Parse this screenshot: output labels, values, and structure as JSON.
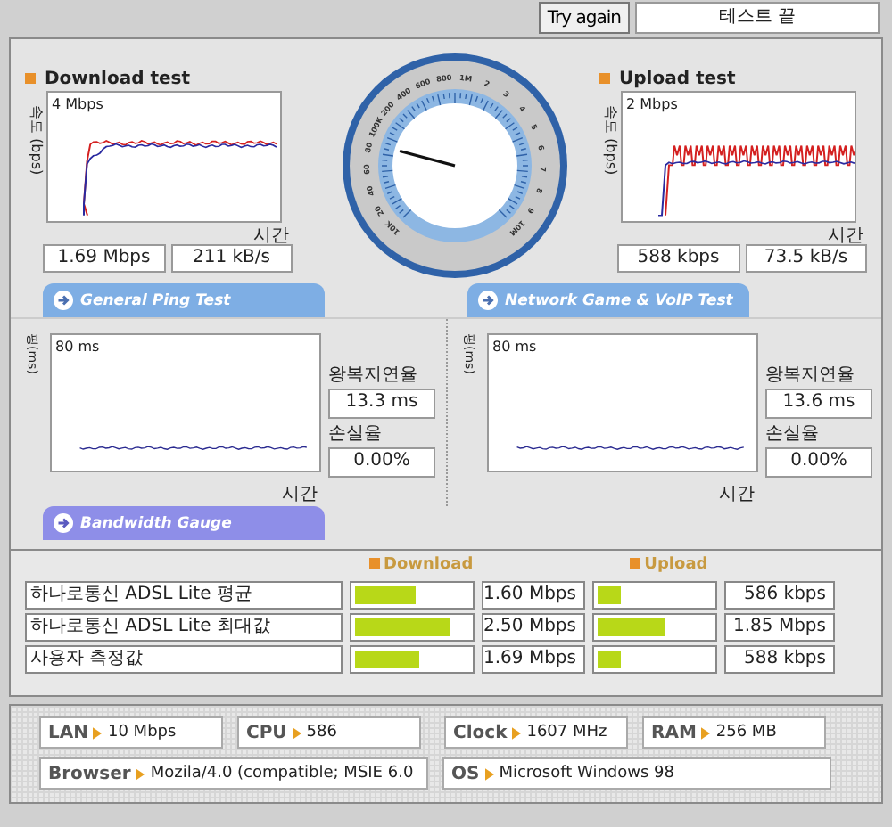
{
  "top_bar": {
    "button": "Try again",
    "status": "테스트 끝"
  },
  "speed_tests": [
    {
      "kind": "smooth",
      "title": "Download test",
      "y_axis": "속도 (bps)",
      "max_label": "4 Mbps",
      "x_axis": "시간",
      "readings": [
        "1.69 Mbps",
        "211 kB/s"
      ]
    },
    {
      "kind": "spiky",
      "title": "Upload test",
      "y_axis": "속도 (bps)",
      "max_label": "2 Mbps",
      "x_axis": "시간",
      "readings": [
        "588 kbps",
        "73.5 kB/s"
      ]
    }
  ],
  "gauge": {
    "labels": [
      "10K",
      "20",
      "40",
      "60",
      "80",
      "100K",
      "200",
      "400",
      "600",
      "800",
      "1M",
      "2",
      "3",
      "4",
      "5",
      "6",
      "7",
      "8",
      "9",
      "10M"
    ]
  },
  "section_tabs": [
    "General Ping Test",
    "Network Game & VoIP Test"
  ],
  "ping_tests": [
    {
      "y_axis": "핑(ms)",
      "max_label": "80 ms",
      "x_axis": "시간",
      "latency_label": "왕복지연율",
      "latency": "13.3 ms",
      "loss_label": "손실율",
      "loss": "0.00%"
    },
    {
      "y_axis": "핑(ms)",
      "max_label": "80 ms",
      "x_axis": "시간",
      "latency_label": "왕복지연율",
      "latency": "13.6 ms",
      "loss_label": "손실율",
      "loss": "0.00%"
    }
  ],
  "bandwidth": {
    "tab": "Bandwidth Gauge",
    "download_header": "Download",
    "upload_header": "Upload",
    "rows": [
      {
        "label": "하나로통신 ADSL Lite 평균",
        "download": {
          "level": 0.53,
          "reading": "1.60 Mbps"
        },
        "upload": {
          "level": 0.2,
          "reading": "586 kbps"
        }
      },
      {
        "label": "하나로통신 ADSL Lite 최대값",
        "download": {
          "level": 0.83,
          "reading": "2.50 Mbps"
        },
        "upload": {
          "level": 0.6,
          "reading": "1.85 Mbps"
        }
      },
      {
        "label": "사용자 측정값",
        "download": {
          "level": 0.56,
          "reading": "1.69 Mbps"
        },
        "upload": {
          "level": 0.21,
          "reading": "588 kbps"
        }
      }
    ]
  },
  "system_info": [
    {
      "items": [
        {
          "label": "LAN",
          "value": "10 Mbps"
        },
        {
          "label": "CPU",
          "value": "586"
        },
        {
          "label": "Clock",
          "value": "1607 MHz"
        },
        {
          "label": "RAM",
          "value": "256 MB"
        }
      ]
    },
    {
      "items": [
        {
          "label": "Browser",
          "value": "Mozila/4.0 (compatible; MSIE 6.0"
        },
        {
          "label": "OS",
          "value": "Microsoft Windows 98"
        }
      ]
    }
  ]
}
